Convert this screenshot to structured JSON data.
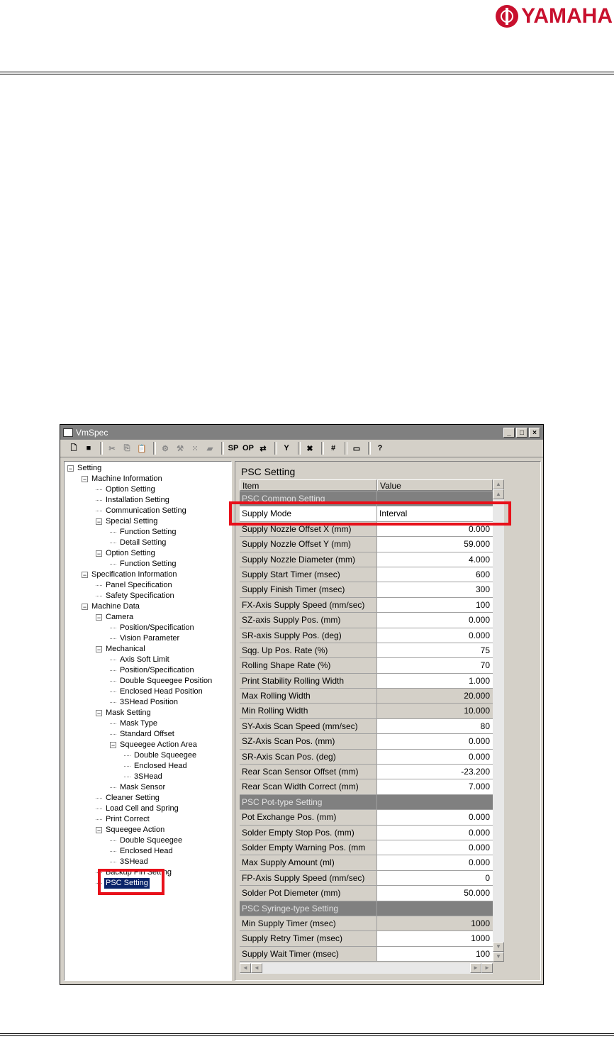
{
  "brand": {
    "logo_text": "YAMAHA",
    "color": "#c8102e"
  },
  "window": {
    "title": "VmSpec",
    "controls": [
      "_",
      "□",
      "×"
    ]
  },
  "toolbar": {
    "buttons": [
      {
        "name": "new-icon",
        "label": "🗋"
      },
      {
        "name": "save-icon",
        "label": "■"
      },
      {
        "name": "cut-icon",
        "label": "✂"
      },
      {
        "name": "copy-icon",
        "label": "⎘"
      },
      {
        "name": "paste-icon",
        "label": "📋"
      },
      {
        "name": "settings-icon",
        "label": "⚙"
      },
      {
        "name": "tool-icon",
        "label": "⚒"
      },
      {
        "name": "dots-icon",
        "label": "⁙"
      },
      {
        "name": "folder-icon",
        "label": "▰"
      },
      {
        "name": "sp-button",
        "label": "SP"
      },
      {
        "name": "op-button",
        "label": "OP"
      },
      {
        "name": "transfer-icon",
        "label": "⇄"
      },
      {
        "name": "filter-icon",
        "label": "Y"
      },
      {
        "name": "delete-icon",
        "label": "✖"
      },
      {
        "name": "grid-icon",
        "label": "#"
      },
      {
        "name": "keyboard-icon",
        "label": "▭"
      },
      {
        "name": "help-icon",
        "label": "?"
      }
    ]
  },
  "tree": [
    {
      "label": "Setting",
      "level": 0,
      "exp": "-"
    },
    {
      "label": "Machine Information",
      "level": 1,
      "exp": "-"
    },
    {
      "label": "Option Setting",
      "level": 2
    },
    {
      "label": "Installation Setting",
      "level": 2
    },
    {
      "label": "Communication Setting",
      "level": 2
    },
    {
      "label": "Special Setting",
      "level": 2,
      "exp": "-"
    },
    {
      "label": "Function Setting",
      "level": 3
    },
    {
      "label": "Detail Setting",
      "level": 3
    },
    {
      "label": "Option Setting",
      "level": 2,
      "exp": "-"
    },
    {
      "label": "Function Setting",
      "level": 3
    },
    {
      "label": "Specification Information",
      "level": 1,
      "exp": "-"
    },
    {
      "label": "Panel Specification",
      "level": 2
    },
    {
      "label": "Safety Specification",
      "level": 2
    },
    {
      "label": "Machine Data",
      "level": 1,
      "exp": "-"
    },
    {
      "label": "Camera",
      "level": 2,
      "exp": "-"
    },
    {
      "label": "Position/Specification",
      "level": 3
    },
    {
      "label": "Vision Parameter",
      "level": 3
    },
    {
      "label": "Mechanical",
      "level": 2,
      "exp": "-"
    },
    {
      "label": "Axis Soft Limit",
      "level": 3
    },
    {
      "label": "Position/Specification",
      "level": 3
    },
    {
      "label": "Double Squeegee Position",
      "level": 3
    },
    {
      "label": "Enclosed Head Position",
      "level": 3
    },
    {
      "label": "3SHead Position",
      "level": 3
    },
    {
      "label": "Mask Setting",
      "level": 2,
      "exp": "-"
    },
    {
      "label": "Mask Type",
      "level": 3
    },
    {
      "label": "Standard Offset",
      "level": 3
    },
    {
      "label": "Squeegee Action Area",
      "level": 3,
      "exp": "-"
    },
    {
      "label": "Double Squeegee",
      "level": 4
    },
    {
      "label": "Enclosed Head",
      "level": 4
    },
    {
      "label": "3SHead",
      "level": 4
    },
    {
      "label": "Mask Sensor",
      "level": 3
    },
    {
      "label": "Cleaner Setting",
      "level": 2
    },
    {
      "label": "Load Cell and Spring",
      "level": 2
    },
    {
      "label": "Print Correct",
      "level": 2
    },
    {
      "label": "Squeegee Action",
      "level": 2,
      "exp": "-"
    },
    {
      "label": "Double Squeegee",
      "level": 3
    },
    {
      "label": "Enclosed Head",
      "level": 3
    },
    {
      "label": "3SHead",
      "level": 3
    },
    {
      "label": "Backup Pin Setting",
      "level": 2
    },
    {
      "label": "PSC Setting",
      "level": 2,
      "selected": true
    }
  ],
  "panel": {
    "heading": "PSC Setting",
    "columns": [
      "Item",
      "Value"
    ],
    "rows": [
      {
        "item": "PSC Common Setting",
        "value": "",
        "type": "sec"
      },
      {
        "item": "Supply Mode",
        "value": "Interval",
        "type": "active"
      },
      {
        "item": "Supply Nozzle Offset X (mm)",
        "value": "0.000"
      },
      {
        "item": "Supply Nozzle Offset Y (mm)",
        "value": "59.000"
      },
      {
        "item": "Supply Nozzle Diameter (mm)",
        "value": "4.000"
      },
      {
        "item": "Supply Start Timer (msec)",
        "value": "600"
      },
      {
        "item": "Supply Finish Timer (msec)",
        "value": "300"
      },
      {
        "item": "FX-Axis Supply Speed (mm/sec)",
        "value": "100"
      },
      {
        "item": "SZ-axis Supply Pos. (mm)",
        "value": "0.000"
      },
      {
        "item": "SR-axis Supply Pos. (deg)",
        "value": "0.000"
      },
      {
        "item": "Sqg. Up Pos. Rate (%)",
        "value": "75"
      },
      {
        "item": "Rolling Shape Rate (%)",
        "value": "70"
      },
      {
        "item": "Print Stability Rolling Width",
        "value": "1.000"
      },
      {
        "item": "Max Rolling Width",
        "value": "20.000",
        "type": "gray"
      },
      {
        "item": "Min Rolling Width",
        "value": "10.000",
        "type": "gray"
      },
      {
        "item": "SY-Axis Scan Speed (mm/sec)",
        "value": "80"
      },
      {
        "item": "SZ-Axis Scan Pos. (mm)",
        "value": "0.000"
      },
      {
        "item": "SR-Axis Scan Pos. (deg)",
        "value": "0.000"
      },
      {
        "item": "Rear Scan Sensor Offset (mm)",
        "value": "-23.200"
      },
      {
        "item": "Rear Scan Width Correct (mm)",
        "value": "7.000"
      },
      {
        "item": "PSC Pot-type Setting",
        "value": "",
        "type": "sec"
      },
      {
        "item": "Pot Exchange Pos. (mm)",
        "value": "0.000"
      },
      {
        "item": "Solder Empty Stop Pos. (mm)",
        "value": "0.000"
      },
      {
        "item": "Solder Empty Warning Pos. (mm",
        "value": "0.000"
      },
      {
        "item": "Max Supply Amount (ml)",
        "value": "0.000"
      },
      {
        "item": "FP-Axis Supply Speed (mm/sec)",
        "value": "0"
      },
      {
        "item": "Solder Pot Diemeter (mm)",
        "value": "50.000"
      },
      {
        "item": "PSC Syringe-type Setting",
        "value": "",
        "type": "sec"
      },
      {
        "item": "Min Supply Timer (msec)",
        "value": "1000",
        "type": "gray"
      },
      {
        "item": "Supply Retry Timer (msec)",
        "value": "1000"
      },
      {
        "item": "Supply Wait Timer (msec)",
        "value": "100"
      }
    ]
  },
  "highlight_color": "#e8101a"
}
